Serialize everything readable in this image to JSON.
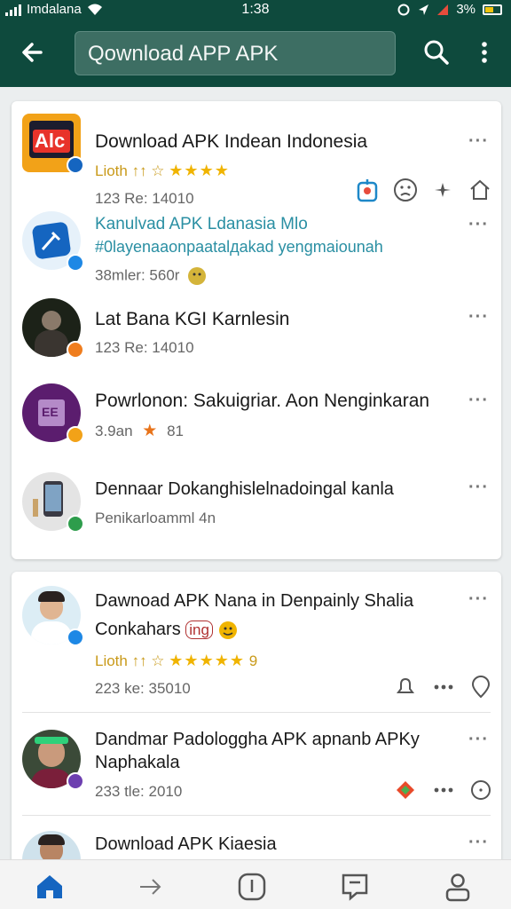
{
  "status_bar": {
    "carrier": "Imdalana",
    "time": "1:38",
    "battery_text": "3%"
  },
  "app_bar": {
    "back_icon": "arrow-left-icon",
    "search_value": "Qownload APP APK",
    "search_icon": "search-icon",
    "more_icon": "more-vertical-icon"
  },
  "card1": {
    "items": [
      {
        "title": "Download APK Indean Indonesia",
        "rating_text": "Lioth ↑↑ ☆",
        "stars": "★★★★",
        "meta": "123 Re: 14010",
        "icon_text": "Alc",
        "more": "···"
      },
      {
        "title": "Kanulvad APK Ldanasia Mlo",
        "line2": "#0layenaaonpaatalдakad yengmaiounah",
        "meta": "38mler: 560r",
        "more": "···"
      },
      {
        "title": "Lat Bana KGI Karnlesin",
        "meta": "123 Re: 14010",
        "more": "···"
      },
      {
        "title": "Powrlonon: Sakuigriar. Aon Nenginkaran",
        "meta": "3.9an",
        "meta_star": "★",
        "meta_after": "81",
        "icon_text": "EE",
        "more": "···"
      },
      {
        "title": "Dennaar Dokanghislelnadoingal kanla",
        "meta": "Penikarloamml 4n",
        "more": "···"
      }
    ]
  },
  "card2": {
    "items": [
      {
        "title": "Dawnoad APK Nana in Denpainly Shalia",
        "subtitle": "Conkahars",
        "subtitle_tag": "ing",
        "rating_text": "Lioth ↑↑ ☆",
        "stars": "★★★★★",
        "rating_after": "9",
        "meta": "223 ke: 35010",
        "more": "···"
      },
      {
        "title": "Dandmar Padologgha APK apnanb APKy",
        "title2": "Naphakala",
        "meta": "233 tle: 2010",
        "more": "···"
      },
      {
        "title": "Download APK Kiaesia",
        "more": "···"
      }
    ]
  },
  "bottom_nav": [
    {
      "icon": "home-icon",
      "active": true
    },
    {
      "icon": "arrow-right-icon",
      "active": false
    },
    {
      "icon": "info-icon",
      "active": false
    },
    {
      "icon": "message-icon",
      "active": false
    },
    {
      "icon": "profile-icon",
      "active": false
    }
  ],
  "colors": {
    "app_bar": "#0e4a3d",
    "accent": "#1565c0",
    "star": "#f0b400"
  }
}
